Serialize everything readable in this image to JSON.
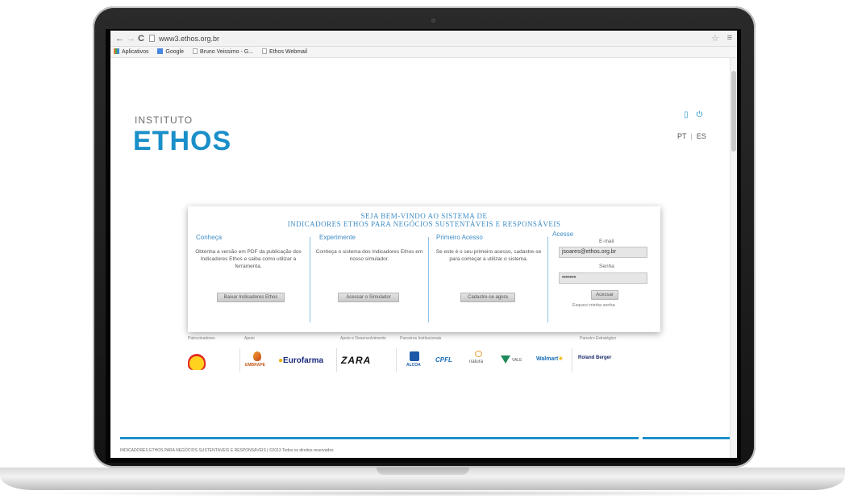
{
  "browser": {
    "url": "www3.ethos.org.br",
    "back_icon": "arrow-left",
    "forward_icon": "arrow-right",
    "reload_icon": "reload",
    "star_icon": "star",
    "menu_icon": "menu",
    "bookmarks": [
      "Aplicativos",
      "Google",
      "Bruno Veissimo - G...",
      "Ethos Webmail"
    ]
  },
  "header": {
    "logo_top": "INSTITUTO",
    "logo_main": "ETHOS",
    "icons": [
      "document-icon",
      "power-icon"
    ],
    "lang_pt": "PT",
    "lang_sep": "|",
    "lang_es": "ES"
  },
  "card": {
    "title_line1": "SEJA BEM-VINDO AO SISTEMA DE",
    "title_line2": "INDICADORES ETHOS PARA NEGÓCIOS SUSTENTÁVEIS E RESPONSÁVEIS",
    "columns": [
      {
        "heading": "Conheça",
        "text": "Obtenha a versão em PDF da publicação dos Indicadores Ethos e saiba como utilizar a ferramenta.",
        "button": "Baixar Indicadores Ethos"
      },
      {
        "heading": "Experimente",
        "text": "Conheça o sistema dos Indicadores Ethos em nosso simulador.",
        "button": "Acessar o Simulador"
      },
      {
        "heading": "Primeiro Acesso",
        "text": "Se este é o seu primeiro acesso, cadastre-se para começar a utilizar o sistema.",
        "button": "Cadastre-se agora"
      }
    ],
    "login": {
      "heading": "Acesse",
      "email_label": "E-mail",
      "email_value": "jsoares@ethos.org.br",
      "password_label": "Senha",
      "password_value": "•••••••",
      "button": "Acessar",
      "forgot": "Esqueci minha senha"
    }
  },
  "sponsors": {
    "labels": [
      "Patrocinadores",
      "Apoio",
      "Apoio e Desenvolvimento",
      "Parceiros Institucionais",
      "Parceiro Estratégico"
    ],
    "logos": [
      "Shell",
      "EMBRAPE",
      "Eurofarma",
      "ZARA",
      "ALCOA",
      "CPFL",
      "natura",
      "VALE",
      "Walmart",
      "Roland Berger"
    ]
  },
  "footer": {
    "text": "INDICADORES ETHOS PARA NEGÓCIOS SUSTENTÁVEIS E RESPONSÁVEIS  |  ©2013 Todos os direitos reservados"
  }
}
